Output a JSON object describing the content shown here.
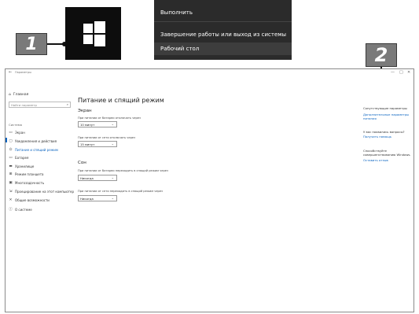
{
  "callouts": [
    "1",
    "2"
  ],
  "context_menu": {
    "items": [
      "Выполнить",
      "Завершение работы или выход из системы",
      "Рабочий стол"
    ]
  },
  "window": {
    "back": "←",
    "title": "Параметры",
    "controls": [
      "—",
      "□",
      "✕"
    ]
  },
  "sidebar": {
    "home": "Главная",
    "search_placeholder": "Найти параметр",
    "section": "Система",
    "items": [
      {
        "label": "Экран",
        "icon": "monitor-icon",
        "glyph": "▭"
      },
      {
        "label": "Уведомления и действия",
        "icon": "notifications-icon",
        "glyph": "▢"
      },
      {
        "label": "Питание и спящий режим",
        "icon": "power-icon",
        "glyph": "⏻"
      },
      {
        "label": "Батарея",
        "icon": "battery-icon",
        "glyph": "▭"
      },
      {
        "label": "Хранилище",
        "icon": "storage-icon",
        "glyph": "▬"
      },
      {
        "label": "Режим планшета",
        "icon": "tablet-icon",
        "glyph": "⊞"
      },
      {
        "label": "Многозадачность",
        "icon": "multitasking-icon",
        "glyph": "▣"
      },
      {
        "label": "Проецирование на этот компьютер",
        "icon": "projecting-icon",
        "glyph": "⇲"
      },
      {
        "label": "Общие возможности",
        "icon": "shared-experiences-icon",
        "glyph": "✕"
      },
      {
        "label": "О системе",
        "icon": "info-icon",
        "glyph": "ⓘ"
      }
    ],
    "active_index": 2
  },
  "main": {
    "title": "Питание и спящий режим",
    "screen": {
      "heading": "Экран",
      "battery_label": "При питании от батареи отключать через",
      "battery_value": "10 минут",
      "ac_label": "При питании от сети отключать через",
      "ac_value": "15 минут"
    },
    "sleep": {
      "heading": "Сон",
      "battery_label": "При питании от батареи переходить в спящий режим через",
      "battery_value": "Никогда",
      "ac_label": "При питании от сети переходить в спящий режим через",
      "ac_value": "Никогда"
    }
  },
  "right_panel": {
    "related_heading": "Сопутствующие параметры",
    "related_link": "Дополнительные параметры питания",
    "question": "У вас появились вопросы?",
    "help_link": "Получить помощь",
    "improve_text": "Способствуйте совершенствованию Windows.",
    "feedback_link": "Оставить отзыв"
  }
}
